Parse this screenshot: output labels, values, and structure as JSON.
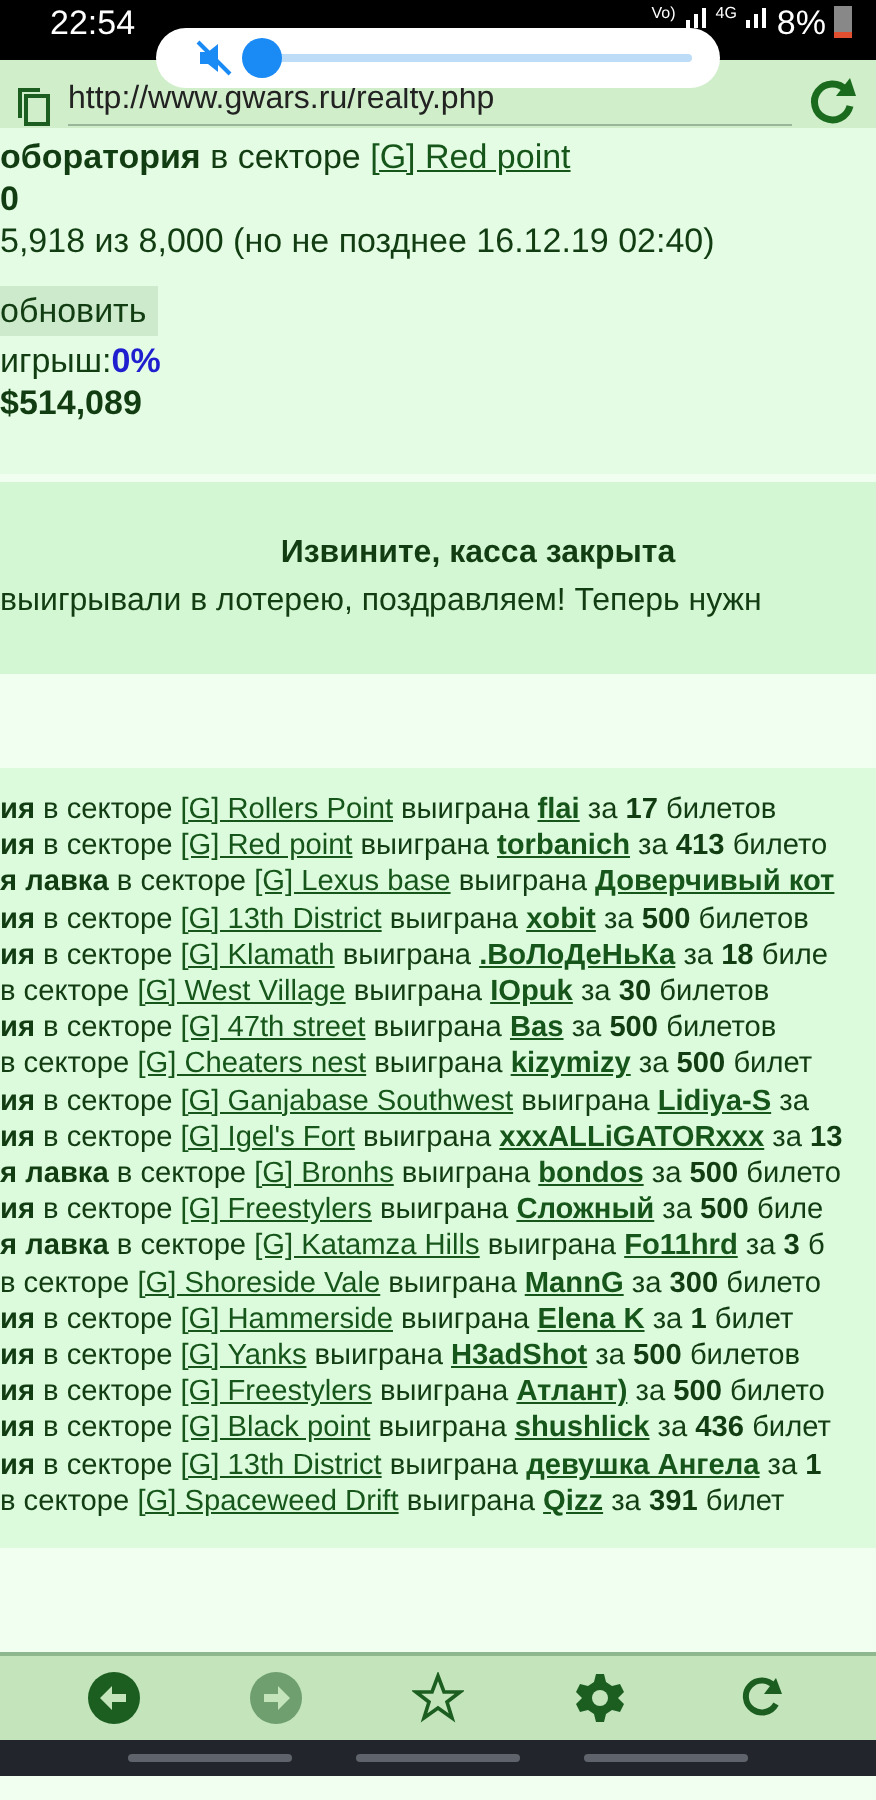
{
  "status_bar": {
    "time": "22:54",
    "volte": "Vo)",
    "network": "4G",
    "battery": "8%"
  },
  "volume_popup": {
    "muted": true,
    "level": 0.03
  },
  "address_bar": {
    "url": "http://www.gwars.ru/realty.php"
  },
  "summary": {
    "location_line": "**оборатория** в секторе ",
    "location_link": "[G] Red point",
    "count": "0",
    "progress": "5,918 из 8,000 (но не позднее 16.12.19 02:40)",
    "refresh_button": "обновить",
    "chance_label": "игрыш: ",
    "chance_value": "0%",
    "jackpot": "$514,089"
  },
  "notice": {
    "title": "Извините, касса закрыта",
    "text": "выигрывали в лотерею, поздравляем! Теперь нужн"
  },
  "results": [
    {
      "object": "ия",
      "in_sector": "в секторе",
      "sector": "[G] Rollers Point",
      "won": "выиграна",
      "winner": "flai",
      "for": "за",
      "count": "17",
      "unit": "билетов"
    },
    {
      "object": "ия",
      "in_sector": "в секторе",
      "sector": "[G] Red point",
      "won": "выиграна",
      "winner": "torbanich",
      "for": "за",
      "count": "413",
      "unit": "билето"
    },
    {
      "object": "я лавка",
      "in_sector": "в секторе",
      "sector": "[G] Lexus base",
      "won": "выиграна",
      "winner": "Доверчивый кот"
    },
    {
      "object": "ия",
      "in_sector": "в секторе",
      "sector": "[G] 13th District",
      "won": "выиграна",
      "winner": "xobit",
      "for": "за",
      "count": "500",
      "unit": "билетов"
    },
    {
      "object": "ия",
      "in_sector": "в секторе",
      "sector": "[G] Klamath",
      "won": "выиграна",
      "winner": ".ВоЛоДеНьКа",
      "for": "за",
      "count": "18",
      "unit": "биле"
    },
    {
      "in_sector": "в секторе",
      "sector": "[G] West Village",
      "won": "выиграна",
      "winner": "IOpuk",
      "for": "за",
      "count": "30",
      "unit": "билетов"
    },
    {
      "object": "ия",
      "in_sector": "в секторе",
      "sector": "[G] 47th street",
      "won": "выиграна",
      "winner": "Bas",
      "for": "за",
      "count": "500",
      "unit": "билетов"
    },
    {
      "in_sector": "в секторе",
      "sector": "[G] Cheaters nest",
      "won": "выиграна",
      "winner": "kizymizy",
      "for": "за",
      "count": "500",
      "unit": "билет"
    },
    {
      "object": "ия",
      "in_sector": "в секторе",
      "sector": "[G] Ganjabase Southwest",
      "won": "выиграна",
      "winner": "Lidiya-S",
      "for": "за"
    },
    {
      "object": "ия",
      "in_sector": "в секторе",
      "sector": "[G] Igel's Fort",
      "won": "выиграна",
      "winner": "xxxALLiGATORxxx",
      "for": "за",
      "count": "13"
    },
    {
      "object": "я лавка",
      "in_sector": "в секторе",
      "sector": "[G] Bronhs",
      "won": "выиграна",
      "winner": "bondos",
      "for": "за",
      "count": "500",
      "unit": "билето"
    },
    {
      "object": "ия",
      "in_sector": "в секторе",
      "sector": "[G] Freestylers",
      "won": "выиграна",
      "winner": "Сложный",
      "for": "за",
      "count": "500",
      "unit": "биле"
    },
    {
      "object": "я лавка",
      "in_sector": "в секторе",
      "sector": "[G] Katamza Hills",
      "won": "выиграна",
      "winner": "Fo11hrd",
      "for": "за",
      "count": "3",
      "unit": "б"
    },
    {
      "in_sector": "в секторе",
      "sector": "[G] Shoreside Vale",
      "won": "выиграна",
      "winner": "MannG",
      "for": "за",
      "count": "300",
      "unit": "билето"
    },
    {
      "object": "ия",
      "in_sector": "в секторе",
      "sector": "[G] Hammerside",
      "won": "выиграна",
      "winner": "Elena K",
      "for": "за",
      "count": "1",
      "unit": "билет"
    },
    {
      "object": "ия",
      "in_sector": "в секторе",
      "sector": "[G] Yanks",
      "won": "выиграна",
      "winner": "H3adShot",
      "for": "за",
      "count": "500",
      "unit": "билетов"
    },
    {
      "object": "ия",
      "in_sector": "в секторе",
      "sector": "[G] Freestylers",
      "won": "выиграна",
      "winner": "Атлант)",
      "for": "за",
      "count": "500",
      "unit": "билето"
    },
    {
      "object": "ия",
      "in_sector": "в секторе",
      "sector": "[G] Black point",
      "won": "выиграна",
      "winner": "shushlick",
      "for": "за",
      "count": "436",
      "unit": "билет"
    },
    {
      "object": "ия",
      "in_sector": "в секторе",
      "sector": "[G] 13th District",
      "won": "выиграна",
      "winner": "девушка Ангела",
      "for": "за",
      "count": "1"
    },
    {
      "in_sector": "в секторе",
      "sector": "[G] Spaceweed Drift",
      "won": "выиграна",
      "winner": "Qizz",
      "for": "за",
      "count": "391",
      "unit": "билет"
    }
  ],
  "toolbar": [
    {
      "kind": "back",
      "disabled": false
    },
    {
      "kind": "forward",
      "disabled": true
    },
    {
      "kind": "star",
      "disabled": false
    },
    {
      "kind": "settings",
      "disabled": false
    },
    {
      "kind": "reload",
      "disabled": false
    }
  ]
}
